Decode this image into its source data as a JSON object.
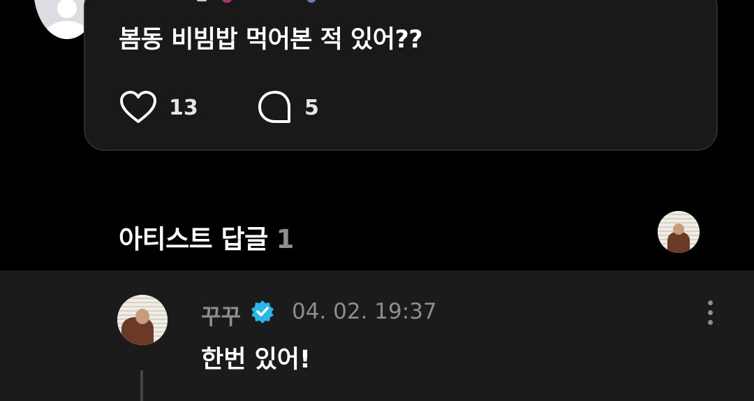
{
  "post": {
    "text": "봄동 비빔밥 먹어본 적 있어??",
    "like_count": "13",
    "comment_count": "5"
  },
  "section": {
    "title": "아티스트 답글",
    "count": "1"
  },
  "reply": {
    "author": "꾸꾸",
    "timestamp": "04. 02. 19:37",
    "text": "한번 있어!"
  },
  "colors": {
    "background": "#000000",
    "card": "#191919",
    "reply_background": "#1b1b1b",
    "muted_text": "#8e8e8e",
    "verified_badge": "#29b6e8"
  }
}
